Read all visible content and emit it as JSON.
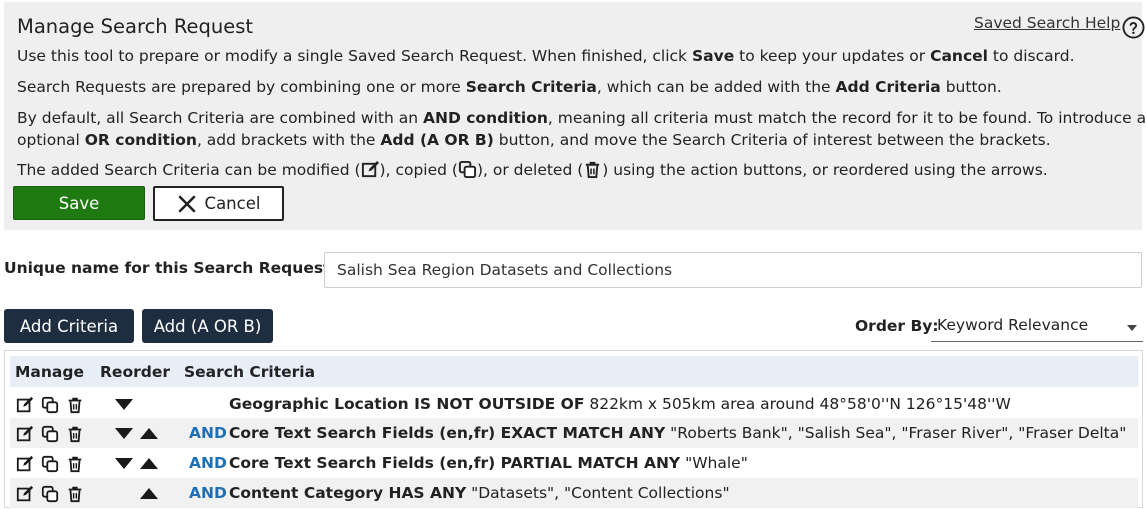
{
  "header": {
    "title": "Manage Search Request",
    "help_link": "Saved Search Help",
    "help_icon": "question-circle-icon"
  },
  "instructions": {
    "p1": {
      "a": "Use this tool to prepare or modify a single Saved Search Request. When finished, click ",
      "b": "Save",
      "c": " to keep your updates or ",
      "d": "Cancel",
      "e": " to discard."
    },
    "p2": {
      "a": "Search Requests are prepared by combining one or more ",
      "b": "Search Criteria",
      "c": ", which can be added with the ",
      "d": "Add Criteria",
      "e": " button."
    },
    "p3": {
      "a": "By default, all Search Criteria are combined with an ",
      "b": "AND condition",
      "c": ", meaning all criteria must match the record for it to be found. To introduce an"
    },
    "p4": {
      "a": "optional ",
      "b": "OR condition",
      "c": ", add brackets with the ",
      "d": "Add (A OR B)",
      "e": " button, and move the Search Criteria of interest between the brackets."
    },
    "p5": {
      "a": "The added Search Criteria can be modified (",
      "b": "), copied (",
      "c": "), or deleted (",
      "d": ") using the action buttons, or reordered using the arrows."
    }
  },
  "actions": {
    "save_label": "Save",
    "cancel_label": "Cancel"
  },
  "name_field": {
    "label": "Unique name for this Search Request:",
    "value": "Salish Sea Region Datasets and Collections"
  },
  "toolbar": {
    "add_criteria_label": "Add Criteria",
    "add_or_label": "Add (A OR B)",
    "order_by_label": "Order By:",
    "order_by_value": "Keyword Relevance"
  },
  "table": {
    "headers": {
      "manage": "Manage",
      "reorder": "Reorder",
      "criteria": "Search Criteria"
    },
    "rows": [
      {
        "connector": "",
        "field": "Geographic Location IS NOT OUTSIDE OF",
        "value": " 822km x 505km area around 48°58'0''N 126°15'48''W",
        "down": true,
        "up": false
      },
      {
        "connector": "AND",
        "field": "Core Text Search Fields (en,fr) EXACT MATCH ANY",
        "value": " \"Roberts Bank\", \"Salish Sea\", \"Fraser River\", \"Fraser Delta\"",
        "down": true,
        "up": true
      },
      {
        "connector": "AND",
        "field": "Core Text Search Fields (en,fr) PARTIAL MATCH ANY",
        "value": " \"Whale\"",
        "down": true,
        "up": true
      },
      {
        "connector": "AND",
        "field": "Content Category HAS ANY",
        "value": " \"Datasets\", \"Content Collections\"",
        "down": false,
        "up": true
      }
    ]
  },
  "colors": {
    "save_green": "#1f7a12",
    "dark_button": "#1e2e40",
    "and_blue": "#1f6fb5",
    "header_row": "#e8eef8"
  }
}
